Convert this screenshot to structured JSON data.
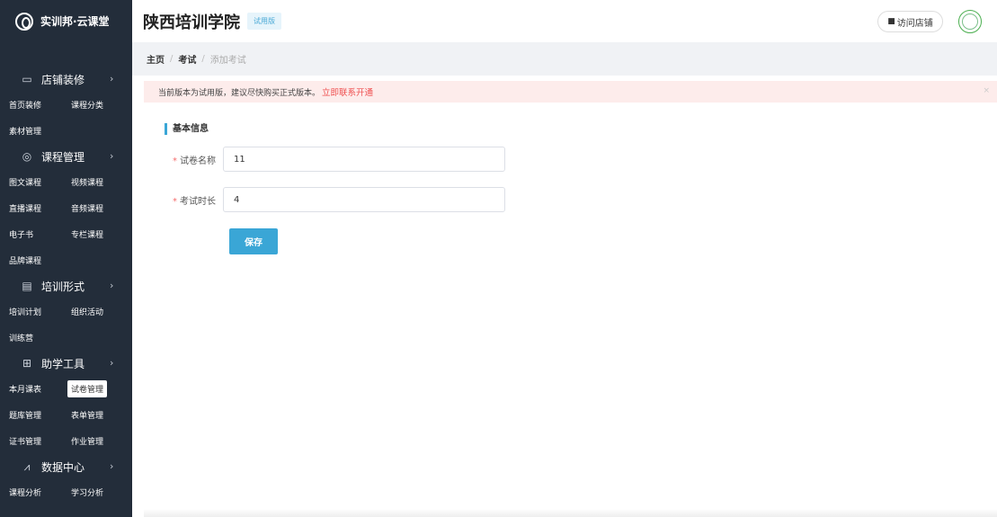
{
  "sidebar": {
    "brand": "实训邦·云课堂",
    "groups": [
      {
        "title": "店铺装修",
        "icon": "store-icon",
        "rows": [
          [
            "首页装修",
            "课程分类"
          ],
          [
            "素材管理"
          ]
        ]
      },
      {
        "title": "课程管理",
        "icon": "course-icon",
        "rows": [
          [
            "图文课程",
            "视频课程"
          ],
          [
            "直播课程",
            "音频课程"
          ],
          [
            "电子书",
            "专栏课程"
          ],
          [
            "品牌课程"
          ]
        ]
      },
      {
        "title": "培训形式",
        "icon": "training-icon",
        "rows": [
          [
            "培训计划",
            "组织活动"
          ],
          [
            "训练营"
          ]
        ]
      },
      {
        "title": "助学工具",
        "icon": "grid-icon",
        "rows": [
          [
            "本月课表",
            "试卷管理"
          ],
          [
            "题库管理",
            "表单管理"
          ],
          [
            "证书管理",
            "作业管理"
          ]
        ]
      },
      {
        "title": "数据中心",
        "icon": "chart-icon",
        "rows": [
          [
            "课程分析",
            "学习分析"
          ]
        ]
      }
    ],
    "active_item": "试卷管理"
  },
  "header": {
    "title": "陕西培训学院",
    "trial_badge": "试用版",
    "visit_store": "访问店铺"
  },
  "breadcrumb": [
    "主页",
    "考试",
    "添加考试"
  ],
  "notice": {
    "text": "当前版本为试用版，建议尽快购买正式版本。",
    "link": "立即联系开通",
    "close": "×"
  },
  "form": {
    "section_title": "基本信息",
    "fields": [
      {
        "label": "试卷名称",
        "value": "11",
        "required": true
      },
      {
        "label": "考试时长",
        "value": "4",
        "required": true
      }
    ],
    "save_label": "保存"
  }
}
